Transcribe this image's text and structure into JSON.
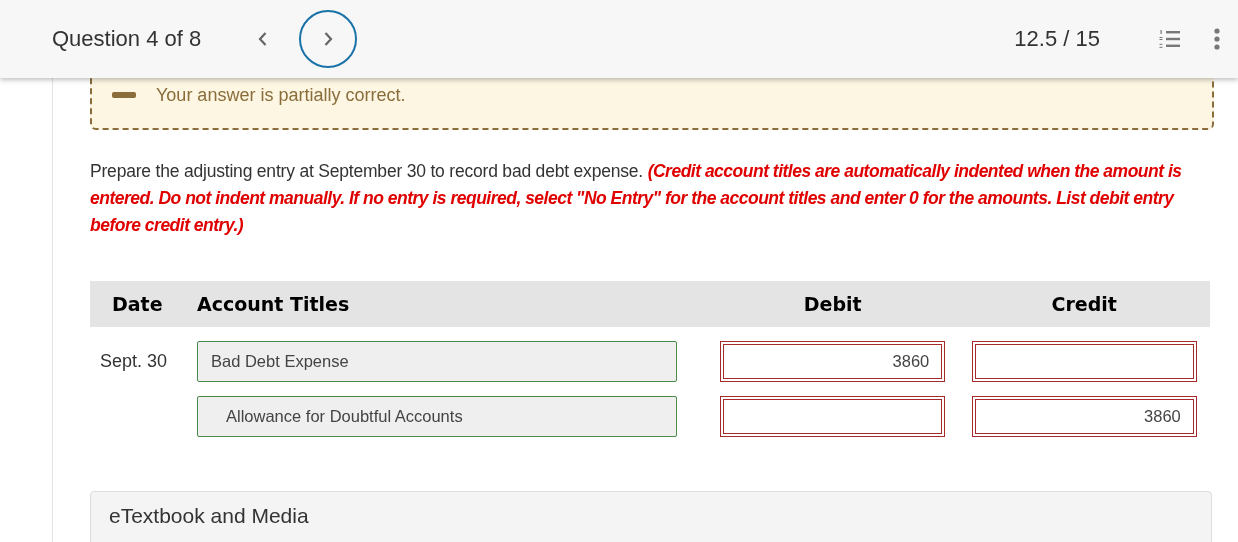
{
  "header": {
    "title": "Question 4 of 8",
    "nav": [
      {
        "kind": "prev",
        "focused": false
      },
      {
        "kind": "next",
        "focused": true
      }
    ],
    "score": "12.5 / 15"
  },
  "feedback": {
    "kind": "partial",
    "message": "Your answer is partially correct."
  },
  "question": {
    "prompt": "Prepare the adjusting entry at September 30 to record bad debt expense.",
    "instructions": "(Credit account titles are automatically indented when the amount is entered. Do not indent manually. If no entry is required, select \"No Entry\" for the account titles and enter 0 for the amounts. List debit entry before credit entry.)"
  },
  "table": {
    "columns": [
      "Date",
      "Account Titles",
      "Debit",
      "Credit"
    ],
    "rows": [
      {
        "date": "Sept. 30",
        "account": {
          "value": "Bad Debt Expense",
          "correct": true,
          "indented": false
        },
        "debit": {
          "value": "3860",
          "correct": false
        },
        "credit": {
          "correct": false
        }
      },
      {
        "account": {
          "value": "Allowance for Doubtful Accounts",
          "correct": true,
          "indented": true
        },
        "debit": {
          "correct": false
        },
        "credit": {
          "value": "3860",
          "correct": false
        }
      }
    ]
  },
  "resources": {
    "title": "eTextbook and Media"
  }
}
